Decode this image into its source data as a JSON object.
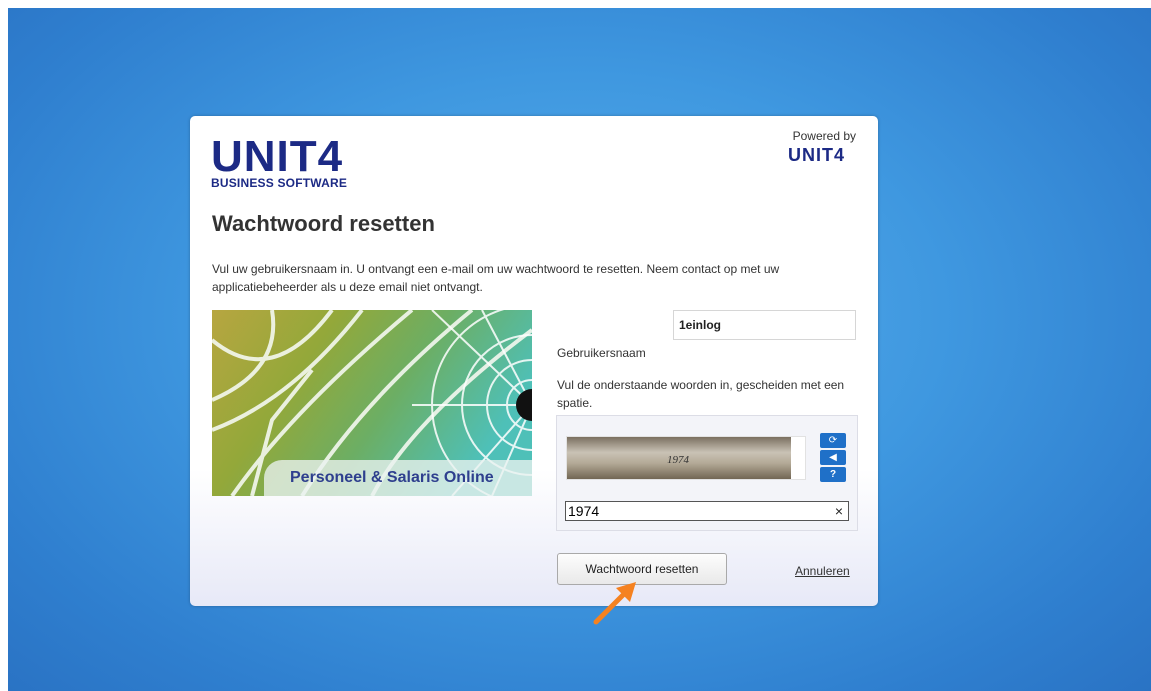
{
  "logo": {
    "main": "UNIT4",
    "sub": "BUSINESS SOFTWARE"
  },
  "powered": {
    "label": "Powered by",
    "brand": "UNIT4"
  },
  "title": "Wachtwoord resetten",
  "intro": "Vul uw gebruikersnaam in. U ontvangt een e-mail om uw wachtwoord te resetten. Neem contact op met uw applicatiebeheerder als u deze email niet ontvangt.",
  "hero": {
    "caption": "Personeel & Salaris Online"
  },
  "form": {
    "username_label": "Gebruikersnaam",
    "username_value": "1einlog",
    "captcha_instruction": "Vul de onderstaande woorden in, gescheiden met een spatie.",
    "captcha_image_text": "1974",
    "captcha_value": "1974",
    "clear_symbol": "×"
  },
  "captcha_buttons": [
    {
      "icon": "refresh-icon",
      "glyph": "⟳"
    },
    {
      "icon": "audio-icon",
      "glyph": "◀"
    },
    {
      "icon": "help-icon",
      "glyph": "?"
    }
  ],
  "actions": {
    "reset_label": "Wachtwoord resetten",
    "cancel_label": "Annuleren"
  },
  "colors": {
    "brand": "#1c2a85",
    "accent_blue": "#1f70c8",
    "arrow": "#f58220"
  }
}
